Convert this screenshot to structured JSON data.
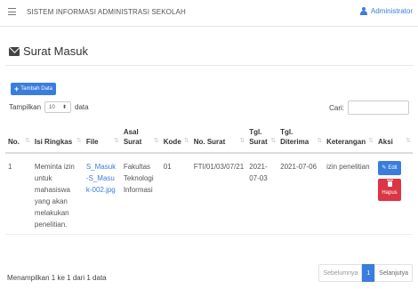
{
  "app": {
    "title": "SISTEM INFORMASI ADMINISTRASI SEKOLAH",
    "user": "Administrator"
  },
  "page": {
    "title": "Surat Masuk",
    "add_label": "Tambah Data"
  },
  "controls": {
    "show_label": "Tampilkan",
    "show_value": "10",
    "show_suffix": "data",
    "search_label": "Cari:",
    "search_value": ""
  },
  "table": {
    "headers": [
      "No.",
      "Isi Ringkas",
      "File",
      "Asal Surat",
      "Kode",
      "No. Surat",
      "Tgl. Surat",
      "Tgl. Diterima",
      "Keterangan",
      "Aksi"
    ],
    "rows": [
      {
        "no": "1",
        "isi": "Meminta izin untuk mahasiswa yang akan melakukan penelitian.",
        "file": "S_Masuk-S_Masuk-002.jpg",
        "asal": "Fakultas Teknologi Informasi",
        "kode": "01",
        "no_surat": "FTI/01/03/07/21",
        "tgl_surat": "2021-07-03",
        "tgl_diterima": "2021-07-06",
        "keterangan": "izin penelitian",
        "edit_label": "Edit",
        "delete_label": "Hapus"
      }
    ]
  },
  "footer": {
    "info": "Menampilkan 1 ke 1 dari 1 data",
    "prev": "Sebelumnya",
    "current": "1",
    "next": "Selanjutya"
  },
  "colors": {
    "primary": "#3b7ddd",
    "danger": "#dc3545"
  }
}
